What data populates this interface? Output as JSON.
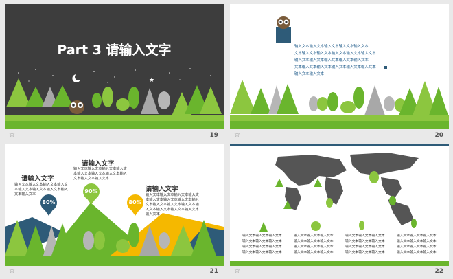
{
  "colors": {
    "green": "#6ab52d",
    "lightgreen": "#8cc63f",
    "dark": "#3d3d3d",
    "navy": "#2e5b78",
    "yellow": "#f5b800"
  },
  "slide19": {
    "title": "Part 3 请输入文字",
    "number": "19",
    "star": "☆"
  },
  "slide20": {
    "number": "20",
    "star": "☆",
    "lines": [
      "输入文本输入文本输入文本输入文本输入文本",
      "文本输入文本输入文本输入文本输入文本输入文本",
      "输入文本输入文本输入文本输入文本输入文本",
      "文本输入文本输入文本输入文本输入文本输入文本",
      "输入文本输入文本"
    ]
  },
  "slide21": {
    "number": "21",
    "star": "☆",
    "items": [
      {
        "heading": "请输入文字",
        "pct": "80%",
        "lines": [
          "输入文本输入文本输入文本输入文",
          "本输入文本输入文本输入文本输入",
          "文本输入文本"
        ]
      },
      {
        "heading": "请输入文字",
        "pct": "90%",
        "lines": [
          "输入文本输入文本输入文本输入文",
          "本输入文本输入文本输入文本输入",
          "文本输入文本输入文本"
        ]
      },
      {
        "heading": "请输入文字",
        "pct": "80%",
        "lines": [
          "输入文本输入文本输入文本输入文",
          "本输入文本输入文本输入文本输入",
          "文本输入文本输入文本输入文本输",
          "入文本输入文本输入文本输入文本",
          "输入文本"
        ]
      }
    ]
  },
  "slide22": {
    "number": "22",
    "star": "☆",
    "captions": [
      [
        "输入文本输入文本输入文本",
        "输入文本输入文本输入文本",
        "输入文本输入文本输入文本",
        "输入文本输入文本输入文本"
      ],
      [
        "输入文本输入文本输入文本",
        "输入文本输入文本输入文本",
        "输入文本输入文本输入文本",
        "输入文本输入文本输入文本"
      ],
      [
        "输入文本输入文本输入文本",
        "输入文本输入文本输入文本",
        "输入文本输入文本输入文本",
        "输入文本输入文本输入文本"
      ],
      [
        "输入文本输入文本输入文本",
        "输入文本输入文本输入文本",
        "输入文本输入文本输入文本",
        "输入文本输入文本输入文本"
      ]
    ]
  }
}
